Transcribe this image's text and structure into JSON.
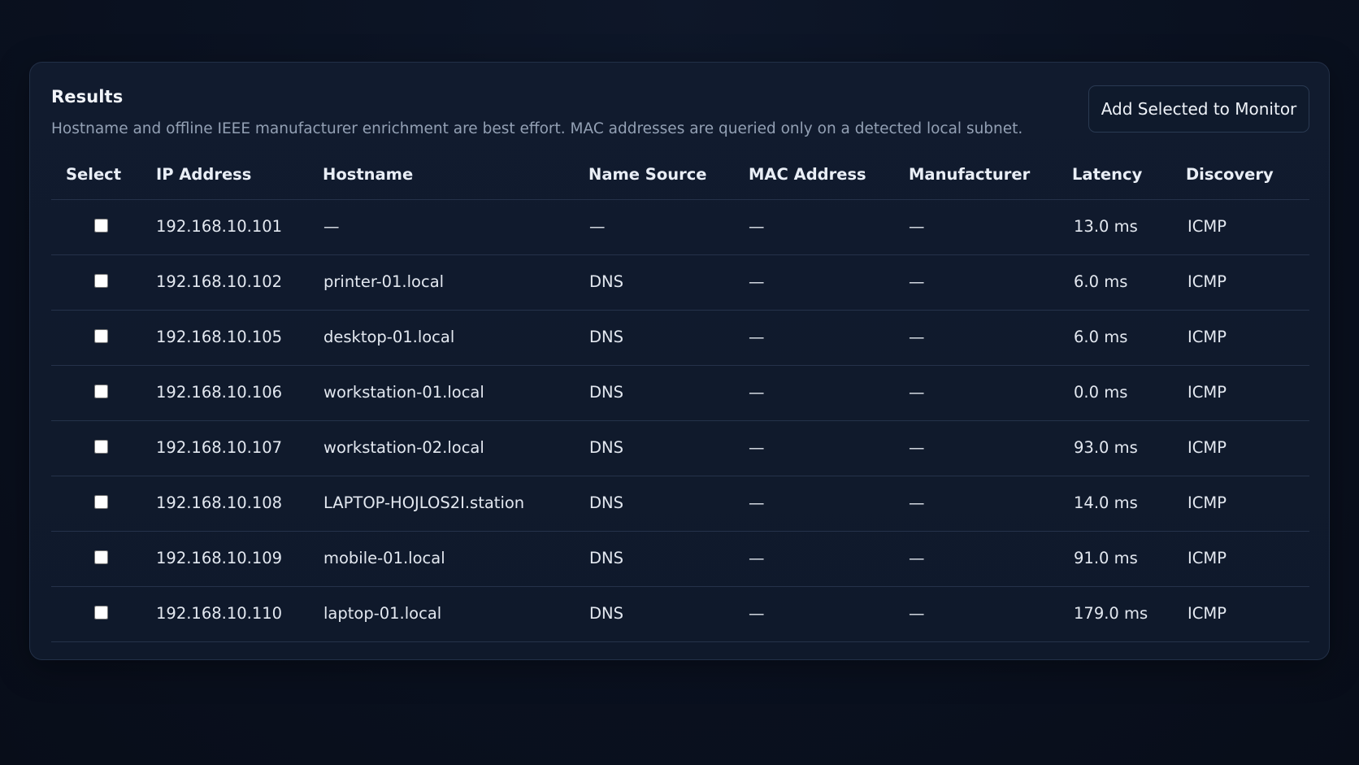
{
  "results": {
    "title": "Results",
    "subtitle": "Hostname and offline IEEE manufacturer enrichment are best effort. MAC addresses are queried only on a detected local subnet.",
    "add_button_label": "Add Selected to Monitor",
    "columns": [
      "Select",
      "IP Address",
      "Hostname",
      "Name Source",
      "MAC Address",
      "Manufacturer",
      "Latency",
      "Discovery"
    ],
    "rows": [
      {
        "selected": false,
        "ip": "192.168.10.101",
        "hostname": "—",
        "name_source": "—",
        "mac": "—",
        "manufacturer": "—",
        "latency": "13.0 ms",
        "discovery": "ICMP"
      },
      {
        "selected": false,
        "ip": "192.168.10.102",
        "hostname": "printer-01.local",
        "name_source": "DNS",
        "mac": "—",
        "manufacturer": "—",
        "latency": "6.0 ms",
        "discovery": "ICMP"
      },
      {
        "selected": false,
        "ip": "192.168.10.105",
        "hostname": "desktop-01.local",
        "name_source": "DNS",
        "mac": "—",
        "manufacturer": "—",
        "latency": "6.0 ms",
        "discovery": "ICMP"
      },
      {
        "selected": false,
        "ip": "192.168.10.106",
        "hostname": "workstation-01.local",
        "name_source": "DNS",
        "mac": "—",
        "manufacturer": "—",
        "latency": "0.0 ms",
        "discovery": "ICMP"
      },
      {
        "selected": false,
        "ip": "192.168.10.107",
        "hostname": "workstation-02.local",
        "name_source": "DNS",
        "mac": "—",
        "manufacturer": "—",
        "latency": "93.0 ms",
        "discovery": "ICMP"
      },
      {
        "selected": false,
        "ip": "192.168.10.108",
        "hostname": "LAPTOP-HOJLOS2I.station",
        "name_source": "DNS",
        "mac": "—",
        "manufacturer": "—",
        "latency": "14.0 ms",
        "discovery": "ICMP"
      },
      {
        "selected": false,
        "ip": "192.168.10.109",
        "hostname": "mobile-01.local",
        "name_source": "DNS",
        "mac": "—",
        "manufacturer": "—",
        "latency": "91.0 ms",
        "discovery": "ICMP"
      },
      {
        "selected": false,
        "ip": "192.168.10.110",
        "hostname": "laptop-01.local",
        "name_source": "DNS",
        "mac": "—",
        "manufacturer": "—",
        "latency": "179.0 ms",
        "discovery": "ICMP"
      }
    ]
  }
}
